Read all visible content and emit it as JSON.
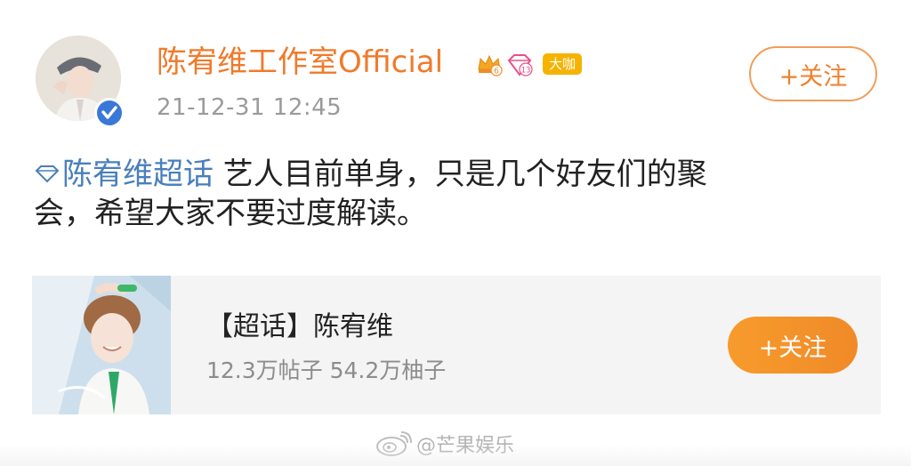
{
  "post": {
    "author": {
      "name": "陈宥维工作室Official",
      "level_badge": "6",
      "vip_badge": "13",
      "tag": "大咖",
      "verified": true
    },
    "timestamp": "21-12-31 12:45",
    "follow_label": "+关注",
    "topic": "陈宥维超话",
    "text_line1": " 艺人目前单身，只是几个好友们的聚",
    "text_line2": "会，希望大家不要过度解读。"
  },
  "supertopic_card": {
    "title": "【超话】陈宥维",
    "stats": "12.3万帖子 54.2万柚子",
    "follow_label": "+关注"
  },
  "watermark": "@芒果娱乐",
  "colors": {
    "name_orange": "#f07a2b",
    "link_blue": "#4a7fbb",
    "follow_gradient_start": "#f79b2c",
    "follow_gradient_end": "#f08a28",
    "verify_blue": "#3a78d8"
  }
}
